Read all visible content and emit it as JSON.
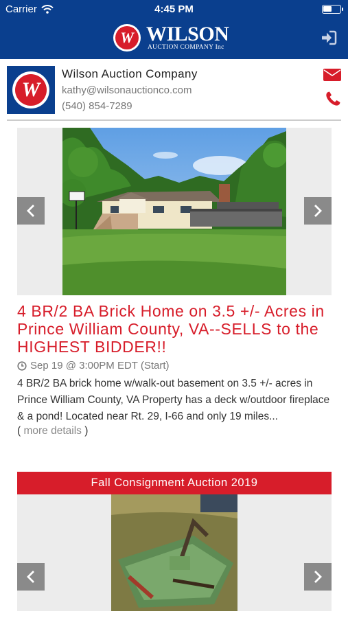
{
  "status_bar": {
    "carrier": "Carrier",
    "time": "4:45 PM",
    "battery_level": 0.5
  },
  "header": {
    "logo_mark": "W",
    "logo_text": "WILSON",
    "logo_subtext": "AUCTION COMPANY Inc"
  },
  "company": {
    "logo_mark": "W",
    "name": "Wilson Auction Company",
    "email": "kathy@wilsonauctionco.com",
    "phone": "(540) 854-7289"
  },
  "listings": [
    {
      "title": "4 BR/2 BA Brick Home on 3.5 +/- Acres in Prince William County, VA--SELLS to the HIGHEST BIDDER!!",
      "date": "Sep 19 @ 3:00PM EDT (Start)",
      "description": "4 BR/2 BA brick home w/walk-out basement on 3.5 +/- acres in Prince William County, VA Property has a deck w/outdoor fireplace & a pond! Located near Rt. 29, I-66 and only 19 miles...",
      "more_open": "(",
      "more_label": "more details",
      "more_close": ")"
    },
    {
      "banner": "Fall Consignment Auction 2019"
    }
  ],
  "colors": {
    "brand_blue": "#0a3f8e",
    "brand_red": "#d71d2a",
    "arrow_gray": "#8a8a8a"
  },
  "icons": [
    "wifi-icon",
    "battery-icon",
    "login-icon",
    "mail-icon",
    "phone-icon",
    "clock-icon",
    "chevron-left-icon",
    "chevron-right-icon"
  ]
}
